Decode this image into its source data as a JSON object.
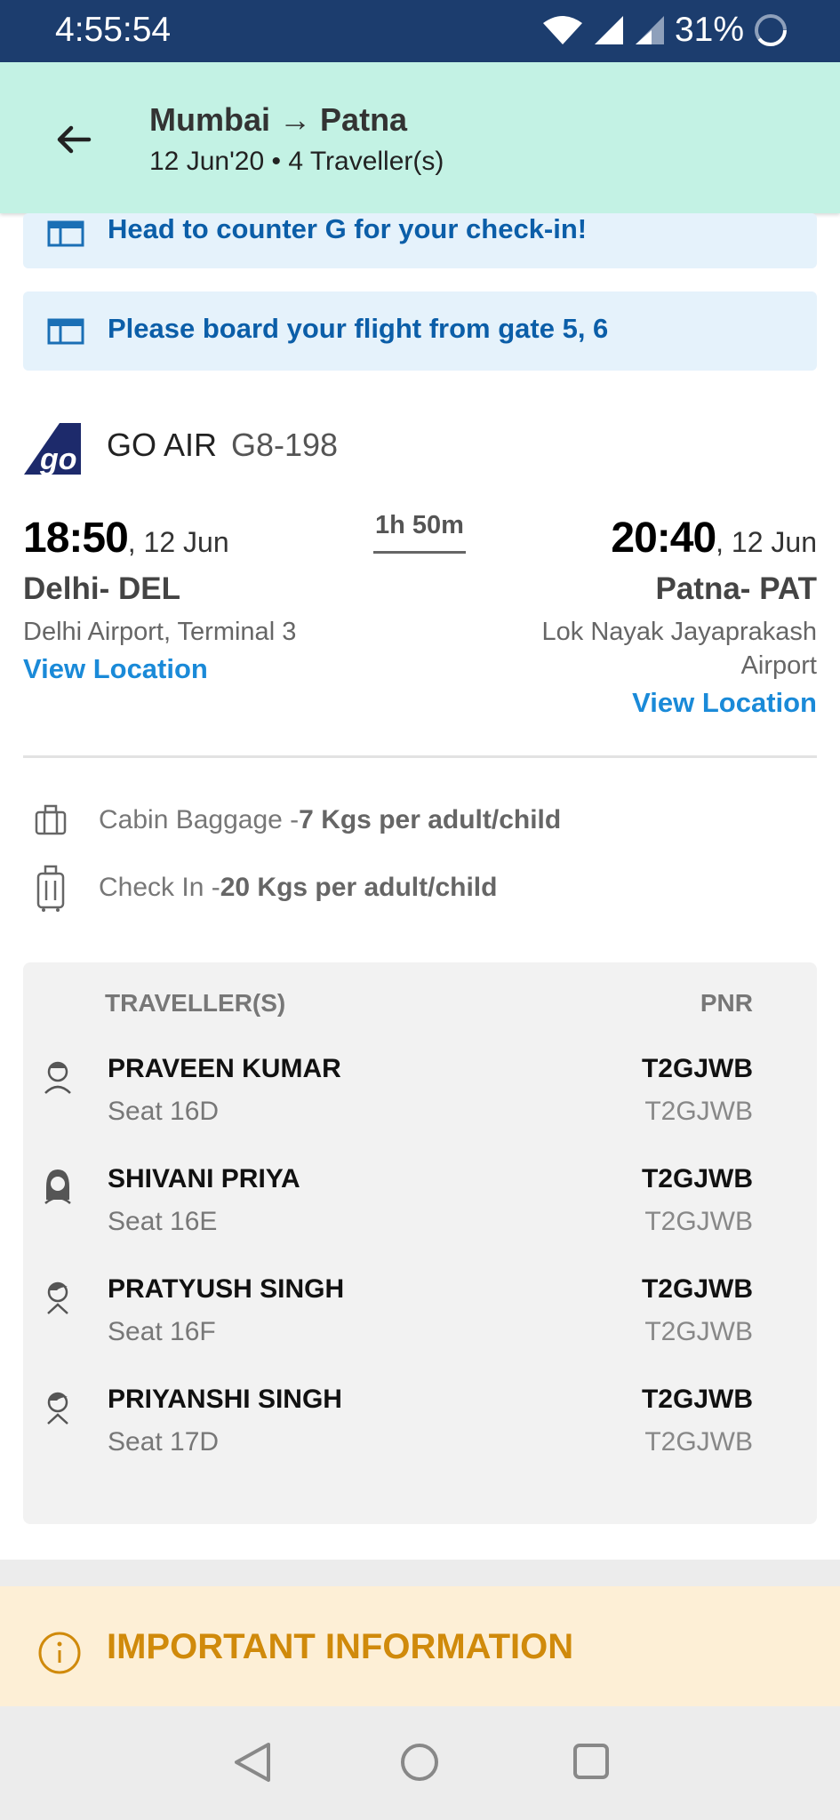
{
  "status_bar": {
    "time": "4:55:54",
    "battery": "31%"
  },
  "header": {
    "route_from": "Mumbai",
    "route_arrow": "→",
    "route_to": "Patna",
    "subtitle": "12 Jun'20 • 4 Traveller(s)"
  },
  "banners": [
    {
      "text": "Head to counter G for your check-in!"
    },
    {
      "text": "Please board your flight from gate 5, 6"
    }
  ],
  "flight": {
    "airline": "GO AIR",
    "flight_no": "G8-198",
    "departure": {
      "time": "18:50",
      "date": ", 12 Jun",
      "city": "Delhi- DEL",
      "airport": "Delhi Airport, Terminal 3",
      "view_location": "View Location"
    },
    "duration": "1h 50m",
    "arrival": {
      "time": "20:40",
      "date": ", 12 Jun",
      "city": "Patna- PAT",
      "airport_line1": "Lok Nayak Jayaprakash",
      "airport_line2": "Airport",
      "view_location": "View Location"
    }
  },
  "baggage": {
    "cabin_label": "Cabin Baggage -",
    "cabin_value": "7 Kgs per adult/child",
    "checkin_label": "Check In -",
    "checkin_value": "20 Kgs per adult/child"
  },
  "travellers": {
    "header_left": "TRAVELLER(S)",
    "header_right": "PNR",
    "rows": [
      {
        "name": "PRAVEEN KUMAR",
        "seat": "Seat 16D",
        "pnr": "T2GJWB",
        "pnr2": "T2GJWB"
      },
      {
        "name": "SHIVANI PRIYA",
        "seat": "Seat 16E",
        "pnr": "T2GJWB",
        "pnr2": "T2GJWB"
      },
      {
        "name": "PRATYUSH SINGH",
        "seat": "Seat 16F",
        "pnr": "T2GJWB",
        "pnr2": "T2GJWB"
      },
      {
        "name": "PRIYANSHI SINGH",
        "seat": "Seat 17D",
        "pnr": "T2GJWB",
        "pnr2": "T2GJWB"
      }
    ]
  },
  "important": {
    "title": "IMPORTANT INFORMATION"
  },
  "icons": {
    "back": "back-arrow-icon",
    "counter": "counter-icon",
    "cabin": "cabin-bag-icon",
    "checkin": "suitcase-icon",
    "person": "person-icon",
    "info": "info-icon"
  },
  "colors": {
    "status_bar": "#1c3d6e",
    "header": "#c3f2e4",
    "banner": "#e5f2fb",
    "link": "#1a8ad8",
    "important": "#d08a0b"
  }
}
